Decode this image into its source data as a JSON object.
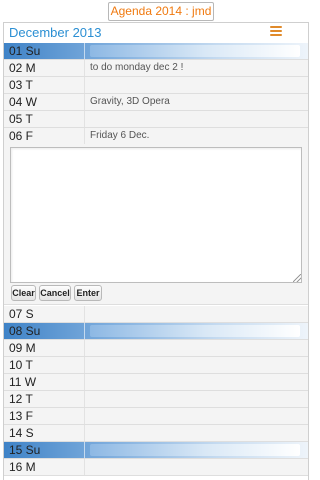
{
  "app": {
    "title": "Agenda 2014 : jmd"
  },
  "calendar": {
    "month_title": "December 2013",
    "menu_icon": "list-menu-icon",
    "days": [
      {
        "label": "01 Su",
        "note": "",
        "sunday": true
      },
      {
        "label": "02 M",
        "note": "to do monday dec 2 !",
        "sunday": false
      },
      {
        "label": "03 T",
        "note": "",
        "sunday": false
      },
      {
        "label": "04 W",
        "note": "Gravity, 3D Opera",
        "sunday": false
      },
      {
        "label": "05 T",
        "note": "",
        "sunday": false
      },
      {
        "label": "06 F",
        "note": "Friday 6 Dec.",
        "sunday": false
      },
      {
        "label": "07 S",
        "note": "",
        "sunday": false
      },
      {
        "label": "08 Su",
        "note": "",
        "sunday": true
      },
      {
        "label": "09 M",
        "note": "",
        "sunday": false
      },
      {
        "label": "10 T",
        "note": "",
        "sunday": false
      },
      {
        "label": "11 W",
        "note": "",
        "sunday": false
      },
      {
        "label": "12 T",
        "note": "",
        "sunday": false
      },
      {
        "label": "13 F",
        "note": "",
        "sunday": false
      },
      {
        "label": "14 S",
        "note": "",
        "sunday": false
      },
      {
        "label": "15 Su",
        "note": "",
        "sunday": true
      },
      {
        "label": "16 M",
        "note": "",
        "sunday": false
      }
    ]
  },
  "editor": {
    "value": "",
    "buttons": {
      "clear": "Clear",
      "cancel": "Cancel",
      "enter": "Enter"
    }
  },
  "colors": {
    "title_orange": "#f07a10",
    "month_blue": "#2b8fd3",
    "sunday_blue": "#3f83c7"
  }
}
